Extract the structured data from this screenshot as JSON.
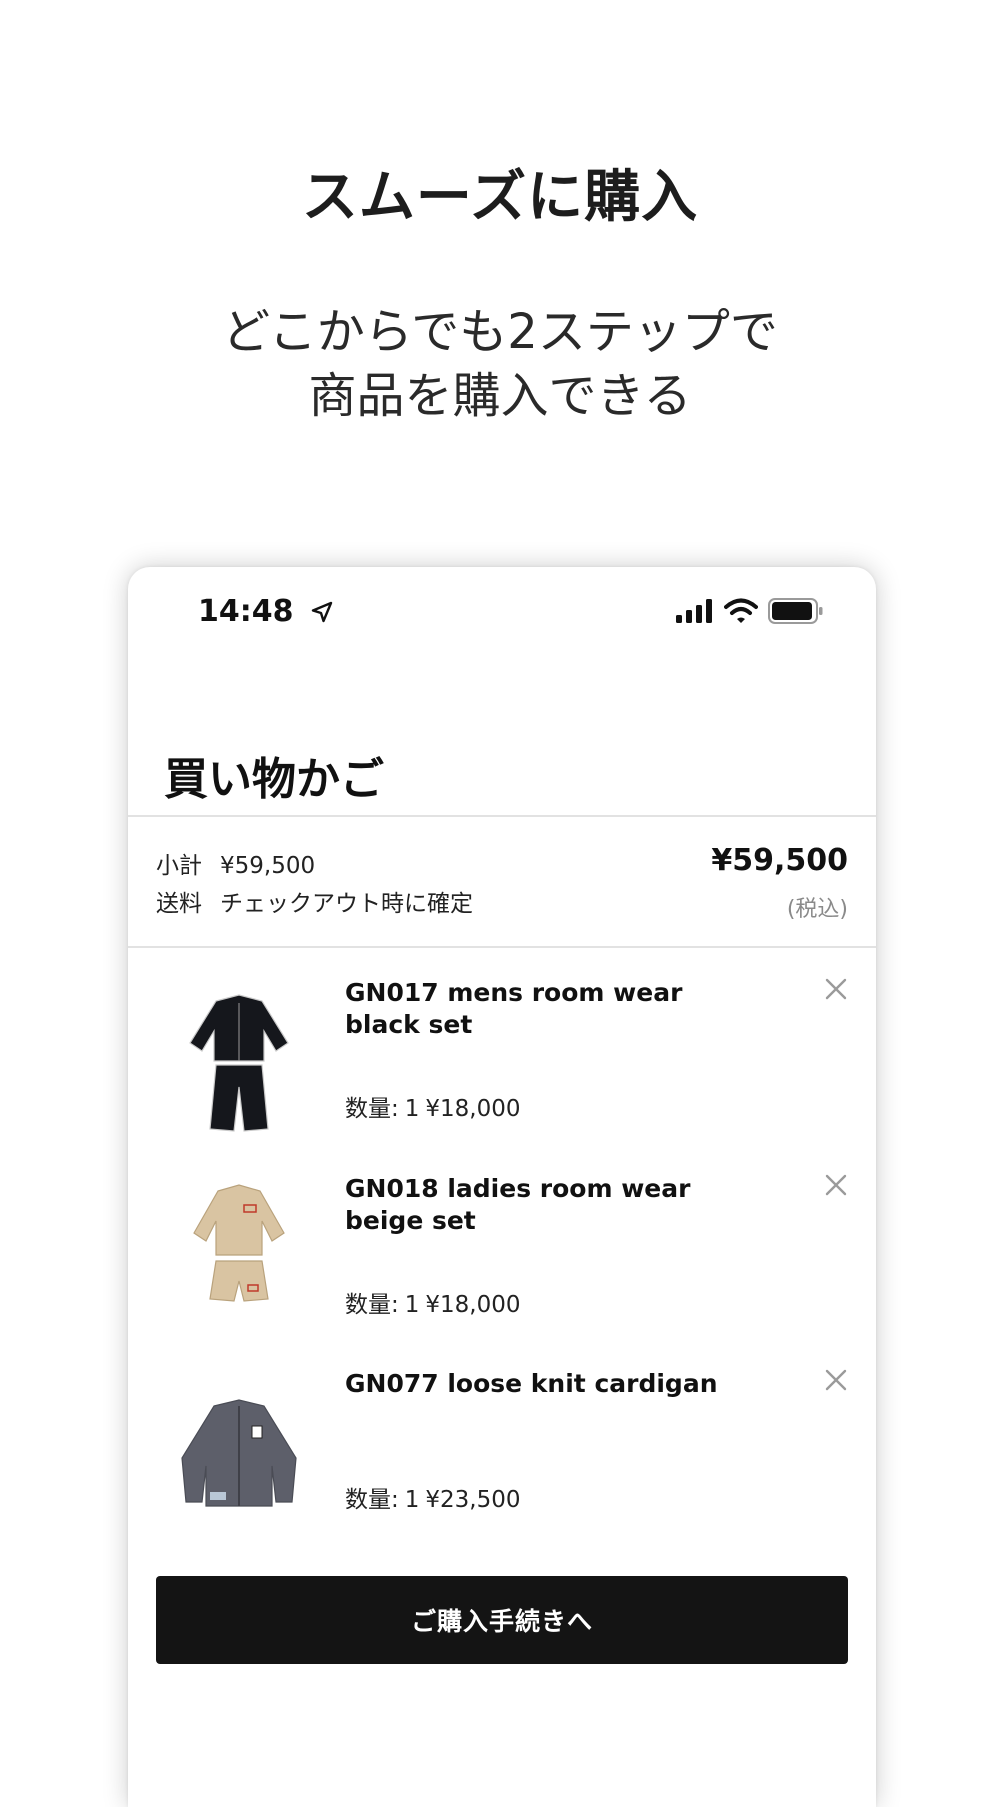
{
  "promo": {
    "title": "スムーズに購入",
    "subtitle_line1": "どこからでも2ステップで",
    "subtitle_line2": "商品を購入できる"
  },
  "status_bar": {
    "time": "14:48",
    "icons": [
      "location-arrow-icon",
      "cellular-signal-icon",
      "wifi-icon",
      "battery-icon"
    ]
  },
  "cart": {
    "title": "買い物かご",
    "subtotal_label": "小計",
    "subtotal_value": "¥59,500",
    "shipping_label": "送料",
    "shipping_value": "チェックアウト時に確定",
    "total": "¥59,500",
    "tax_note": "(税込)",
    "items": [
      {
        "name": "GN017 mens room wear black set",
        "qty_label": "数量:",
        "qty": "1",
        "price": "¥18,000",
        "thumb_color": "#15171c"
      },
      {
        "name": "GN018 ladies room wear beige set",
        "qty_label": "数量:",
        "qty": "1",
        "price": "¥18,000",
        "thumb_color": "#d9c4a2"
      },
      {
        "name": "GN077 loose knit cardigan",
        "qty_label": "数量:",
        "qty": "1",
        "price": "¥23,500",
        "thumb_color": "#5d5f6a"
      }
    ],
    "checkout_label": "ご購入手続きへ"
  },
  "colors": {
    "button_bg": "#141414",
    "divider": "#e2e2e2",
    "muted_text": "#8a8a8a"
  }
}
